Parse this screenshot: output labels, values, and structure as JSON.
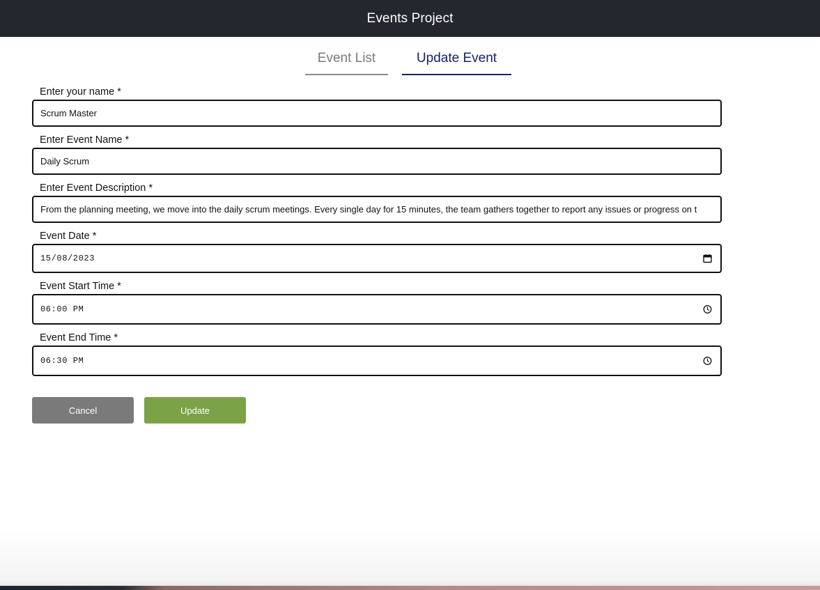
{
  "app": {
    "title": "Events Project"
  },
  "tabs": [
    {
      "label": "Event List",
      "active": false
    },
    {
      "label": "Update Event",
      "active": true
    }
  ],
  "form": {
    "name": {
      "label": "Enter your name *",
      "value": "Scrum Master"
    },
    "event_name": {
      "label": "Enter Event Name *",
      "value": "Daily Scrum"
    },
    "description": {
      "label": "Enter Event Description *",
      "value": "From the planning meeting, we move into the daily scrum meetings. Every single day for 15 minutes, the team gathers together to report any issues or progress on t"
    },
    "date": {
      "label": "Event Date *",
      "value": "15/08/2023",
      "icon": "calendar-icon"
    },
    "start_time": {
      "label": "Event Start Time *",
      "value": "06:00 PM",
      "icon": "clock-icon"
    },
    "end_time": {
      "label": "Event End Time *",
      "value": "06:30 PM",
      "icon": "clock-icon"
    }
  },
  "buttons": {
    "cancel": "Cancel",
    "update": "Update"
  },
  "colors": {
    "navbar": "#24272e",
    "active_tab": "#15206e",
    "cancel_button": "#7a7a7a",
    "update_button": "#7ca248"
  }
}
